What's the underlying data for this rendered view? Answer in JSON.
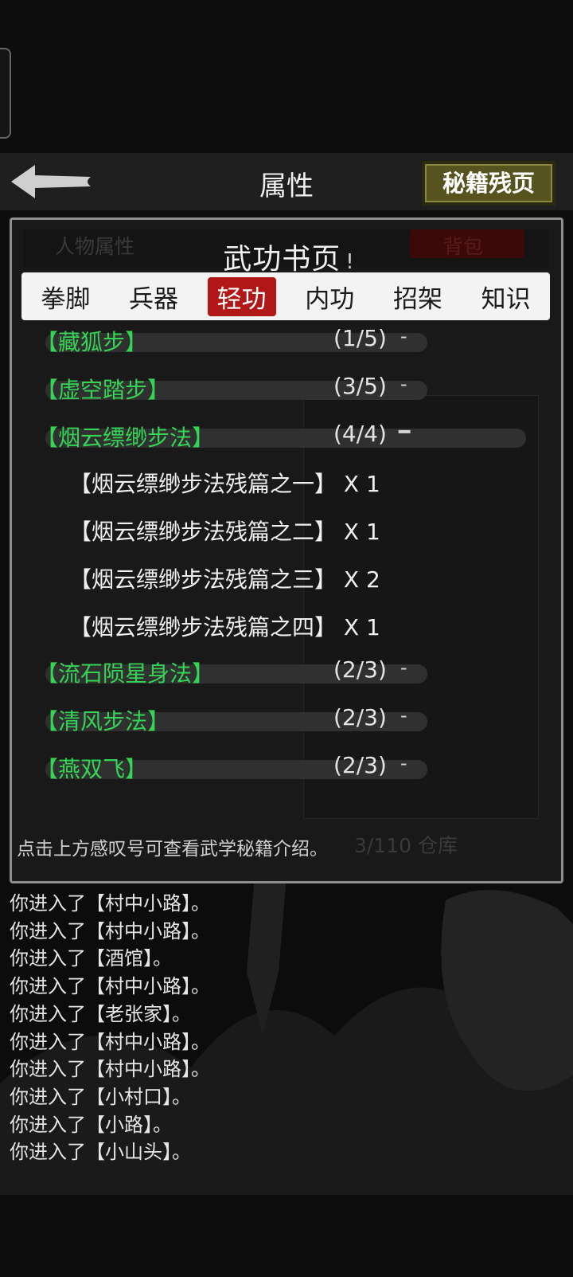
{
  "header": {
    "title": "属性",
    "right_button": "秘籍残页"
  },
  "panel": {
    "title": "武功书页",
    "info_mark": "!",
    "tabs": [
      {
        "label": "拳脚",
        "active": false
      },
      {
        "label": "兵器",
        "active": false
      },
      {
        "label": "轻功",
        "active": true
      },
      {
        "label": "内功",
        "active": false
      },
      {
        "label": "招架",
        "active": false
      },
      {
        "label": "知识",
        "active": false
      }
    ],
    "skills": [
      {
        "name": "【藏狐步】",
        "count": "(1/5)",
        "toggle": "-",
        "expanded": false
      },
      {
        "name": "【虚空踏步】",
        "count": "(3/5)",
        "toggle": "-",
        "expanded": false
      },
      {
        "name": "【烟云缥缈步法】",
        "count": "(4/4)",
        "toggle": "━",
        "expanded": true,
        "pages": [
          "【烟云缥缈步法残篇之一】 X 1",
          "【烟云缥缈步法残篇之二】 X 1",
          "【烟云缥缈步法残篇之三】 X 2",
          "【烟云缥缈步法残篇之四】 X 1"
        ]
      },
      {
        "name": "【流石陨星身法】",
        "count": "(2/3)",
        "toggle": "-",
        "expanded": false
      },
      {
        "name": "【清风步法】",
        "count": "(2/3)",
        "toggle": "-",
        "expanded": false
      },
      {
        "name": "【燕双飞】",
        "count": "(2/3)",
        "toggle": "-",
        "expanded": false
      }
    ],
    "hint": "点击上方感叹号可查看武学秘籍介绍。",
    "background_ghost": {
      "header_left": "人物属性",
      "header_right": "背包",
      "storage": "3/110 仓库"
    }
  },
  "log": [
    "你进入了【村中小路】。",
    "你进入了【村中小路】。",
    "你进入了【酒馆】。",
    "你进入了【村中小路】。",
    "你进入了【老张家】。",
    "你进入了【村中小路】。",
    "你进入了【村中小路】。",
    "你进入了【小村口】。",
    "你进入了【小路】。",
    "你进入了【小山头】。"
  ],
  "colors": {
    "skill_green": "#34d455",
    "active_tab_red": "#b21717",
    "button_olive": "#56531e"
  }
}
